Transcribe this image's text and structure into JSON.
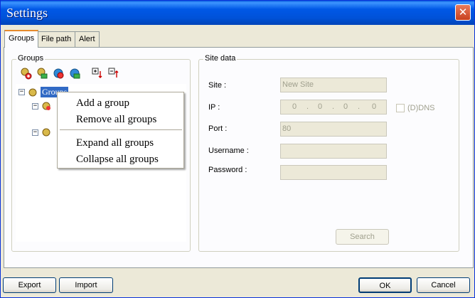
{
  "window": {
    "title": "Settings",
    "close_icon": "close-icon"
  },
  "tabs": [
    {
      "label": "Groups",
      "active": true
    },
    {
      "label": "File path",
      "active": false
    },
    {
      "label": "Alert",
      "active": false
    }
  ],
  "groups_panel": {
    "label": "Groups",
    "toolbar": [
      "add-group-icon",
      "add-site-icon",
      "edit-group-icon",
      "delete-group-icon",
      "expand-all-icon",
      "collapse-all-icon"
    ],
    "tree_root_label": "Groups"
  },
  "context_menu": {
    "items": [
      "Add a group",
      "Remove all groups",
      "Expand all groups",
      "Collapse all groups"
    ]
  },
  "site_data": {
    "label": "Site data",
    "site_label": "Site :",
    "site_value": "New Site",
    "ip_label": "IP :",
    "ip_octets": [
      "0",
      "0",
      "0",
      "0"
    ],
    "dns_label": "(D)DNS",
    "port_label": "Port :",
    "port_value": "80",
    "username_label": "Username :",
    "username_value": "",
    "password_label": "Password :",
    "password_value": "",
    "search_label": "Search"
  },
  "footer": {
    "export_label": "Export",
    "import_label": "Import",
    "ok_label": "OK",
    "cancel_label": "Cancel"
  }
}
